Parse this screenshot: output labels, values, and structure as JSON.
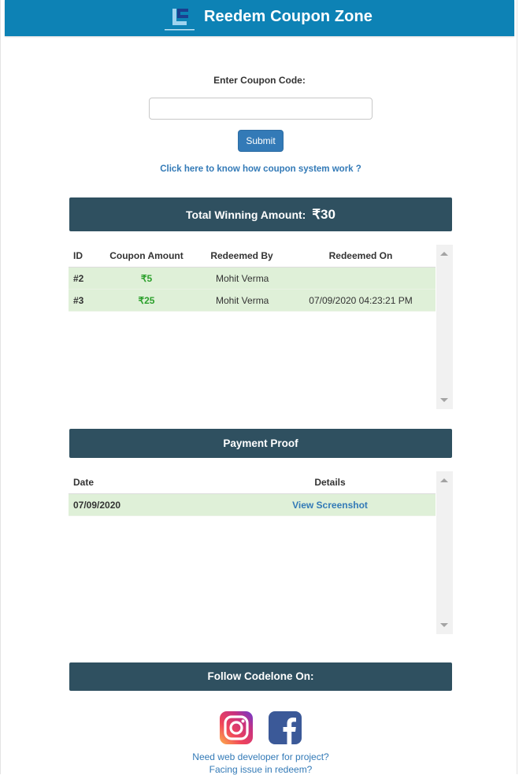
{
  "header": {
    "title": "Reedem Coupon Zone"
  },
  "coupon_form": {
    "label": "Enter Coupon Code:",
    "input_value": "",
    "input_placeholder": "",
    "submit_label": "Submit",
    "help_link": "Click here to know how coupon system work ?"
  },
  "total": {
    "label": "Total Winning Amount:",
    "amount": "₹30"
  },
  "coupons_table": {
    "headers": [
      "ID",
      "Coupon Amount",
      "Redeemed By",
      "Redeemed On"
    ],
    "rows": [
      {
        "id": "#2",
        "amount": "₹5",
        "redeemed_by": "Mohit Verma",
        "redeemed_on": ""
      },
      {
        "id": "#3",
        "amount": "₹25",
        "redeemed_by": "Mohit Verma",
        "redeemed_on": "07/09/2020 04:23:21 PM"
      }
    ]
  },
  "payment_proof": {
    "title": "Payment Proof",
    "headers": [
      "Date",
      "Details"
    ],
    "rows": [
      {
        "date": "07/09/2020",
        "details": "View Screenshot"
      }
    ]
  },
  "follow": {
    "title": "Follow Codelone On:"
  },
  "footer": {
    "line1": "Need web developer for project?",
    "line2": "Facing issue in redeem?"
  },
  "colors": {
    "header": "#0d82b5",
    "section_bar": "#2f5060",
    "row_highlight": "#dff0d8",
    "link": "#337ab7",
    "amount_green": "#2ca02c",
    "button": "#337ab7"
  },
  "icons": [
    "codelone-logo",
    "instagram-icon",
    "facebook-icon"
  ]
}
